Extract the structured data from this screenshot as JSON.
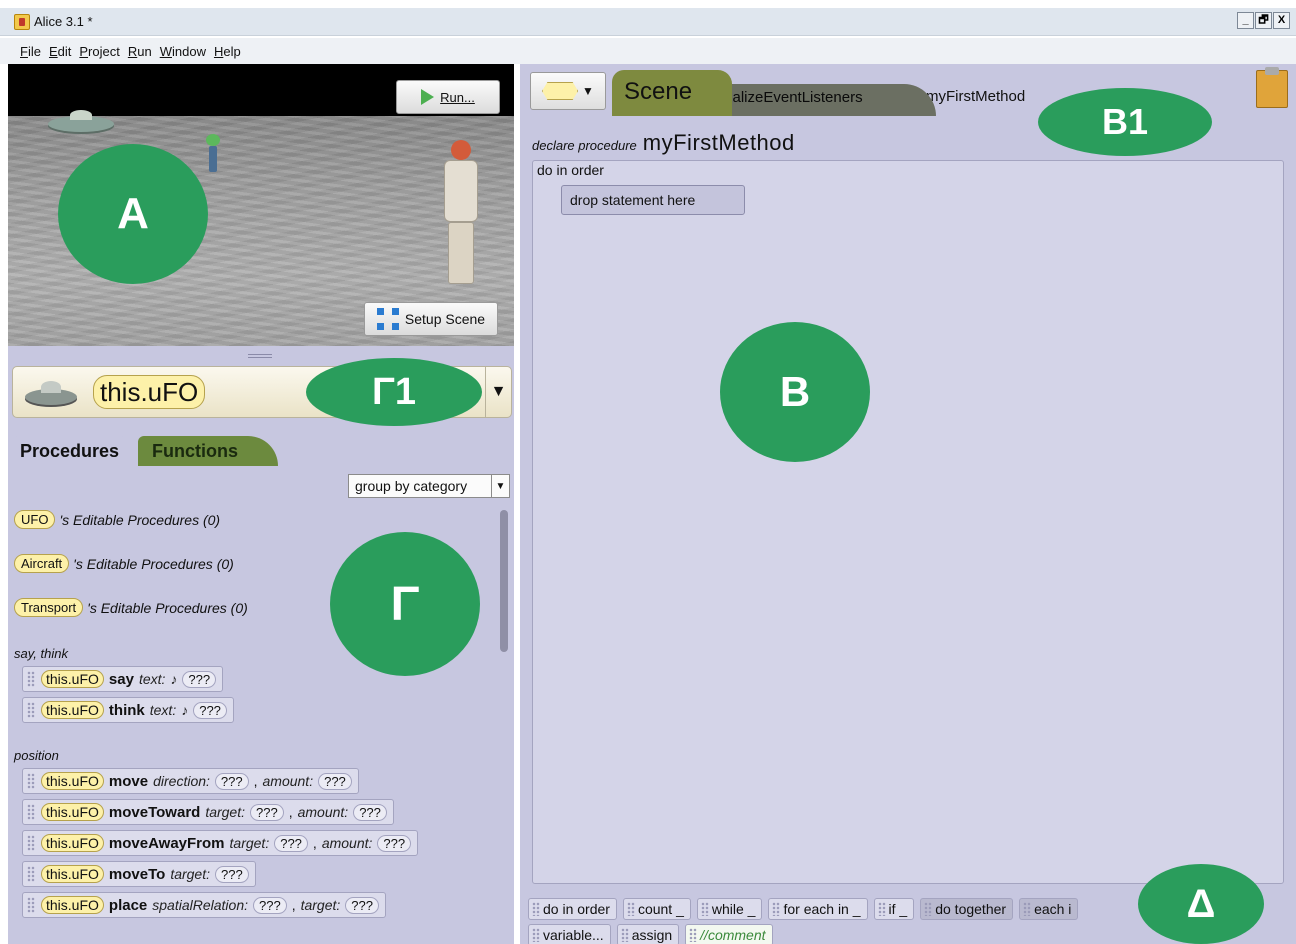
{
  "window": {
    "title": "Alice 3.1  *",
    "controls": [
      "_",
      "🗗",
      "X"
    ]
  },
  "menu": [
    "File",
    "Edit",
    "Project",
    "Run",
    "Window",
    "Help"
  ],
  "scene": {
    "run_label": "Run...",
    "setup_label": "Setup Scene"
  },
  "selector": {
    "value": "this.uFO",
    "arrow": "▼"
  },
  "left_tabs": {
    "procedures": "Procedures",
    "functions": "Functions"
  },
  "group_select": {
    "value": "group by category",
    "arrow": "▼"
  },
  "editable": [
    {
      "type": "UFO",
      "label": "'s Editable Procedures (0)"
    },
    {
      "type": "Aircraft",
      "label": "'s Editable Procedures (0)"
    },
    {
      "type": "Transport",
      "label": "'s Editable Procedures (0)"
    }
  ],
  "categories": {
    "say_think": "say, think",
    "position": "position"
  },
  "statements": [
    {
      "obj": "this.uFO",
      "method": "say",
      "p1": "text:",
      "p1sym": "♪",
      "v1": "???",
      "p2": "",
      "v2": ""
    },
    {
      "obj": "this.uFO",
      "method": "think",
      "p1": "text:",
      "p1sym": "♪",
      "v1": "???",
      "p2": "",
      "v2": ""
    },
    {
      "obj": "this.uFO",
      "method": "move",
      "p1": "direction:",
      "p1sym": "",
      "v1": "???",
      "p2": "amount:",
      "v2": "???"
    },
    {
      "obj": "this.uFO",
      "method": "moveToward",
      "p1": "target:",
      "p1sym": "",
      "v1": "???",
      "p2": "amount:",
      "v2": "???"
    },
    {
      "obj": "this.uFO",
      "method": "moveAwayFrom",
      "p1": "target:",
      "p1sym": "",
      "v1": "???",
      "p2": "amount:",
      "v2": "???"
    },
    {
      "obj": "this.uFO",
      "method": "moveTo",
      "p1": "target:",
      "p1sym": "",
      "v1": "???",
      "p2": "",
      "v2": ""
    },
    {
      "obj": "this.uFO",
      "method": "place",
      "p1": "spatialRelation:",
      "p1sym": "",
      "v1": "???",
      "p2": "target:",
      "v2": "???"
    }
  ],
  "editor_tabs": {
    "scene": "Scene",
    "init": "initializeEventListeners",
    "current": "myFirstMethod"
  },
  "editor": {
    "declare_keyword": "declare procedure",
    "method_name": "myFirstMethod",
    "do_in_order": "do in order",
    "drop_here": "drop statement here"
  },
  "controls_row1": [
    "do in order",
    "count _",
    "while _",
    "for each in _",
    "if _",
    "do together",
    "each i"
  ],
  "controls_row2": [
    "variable...",
    "assign",
    "//comment"
  ],
  "markers": {
    "a": "A",
    "b": "B",
    "b1": "B1",
    "g": "Γ",
    "g1": "Γ1",
    "d": "Δ"
  },
  "colors": {
    "marker": "#2a9d5c",
    "panel": "#c7c7e0",
    "object_pill": "#fdf1a9",
    "scene_tab": "#7e8a3f",
    "functions_tab": "#6c8a3e"
  }
}
